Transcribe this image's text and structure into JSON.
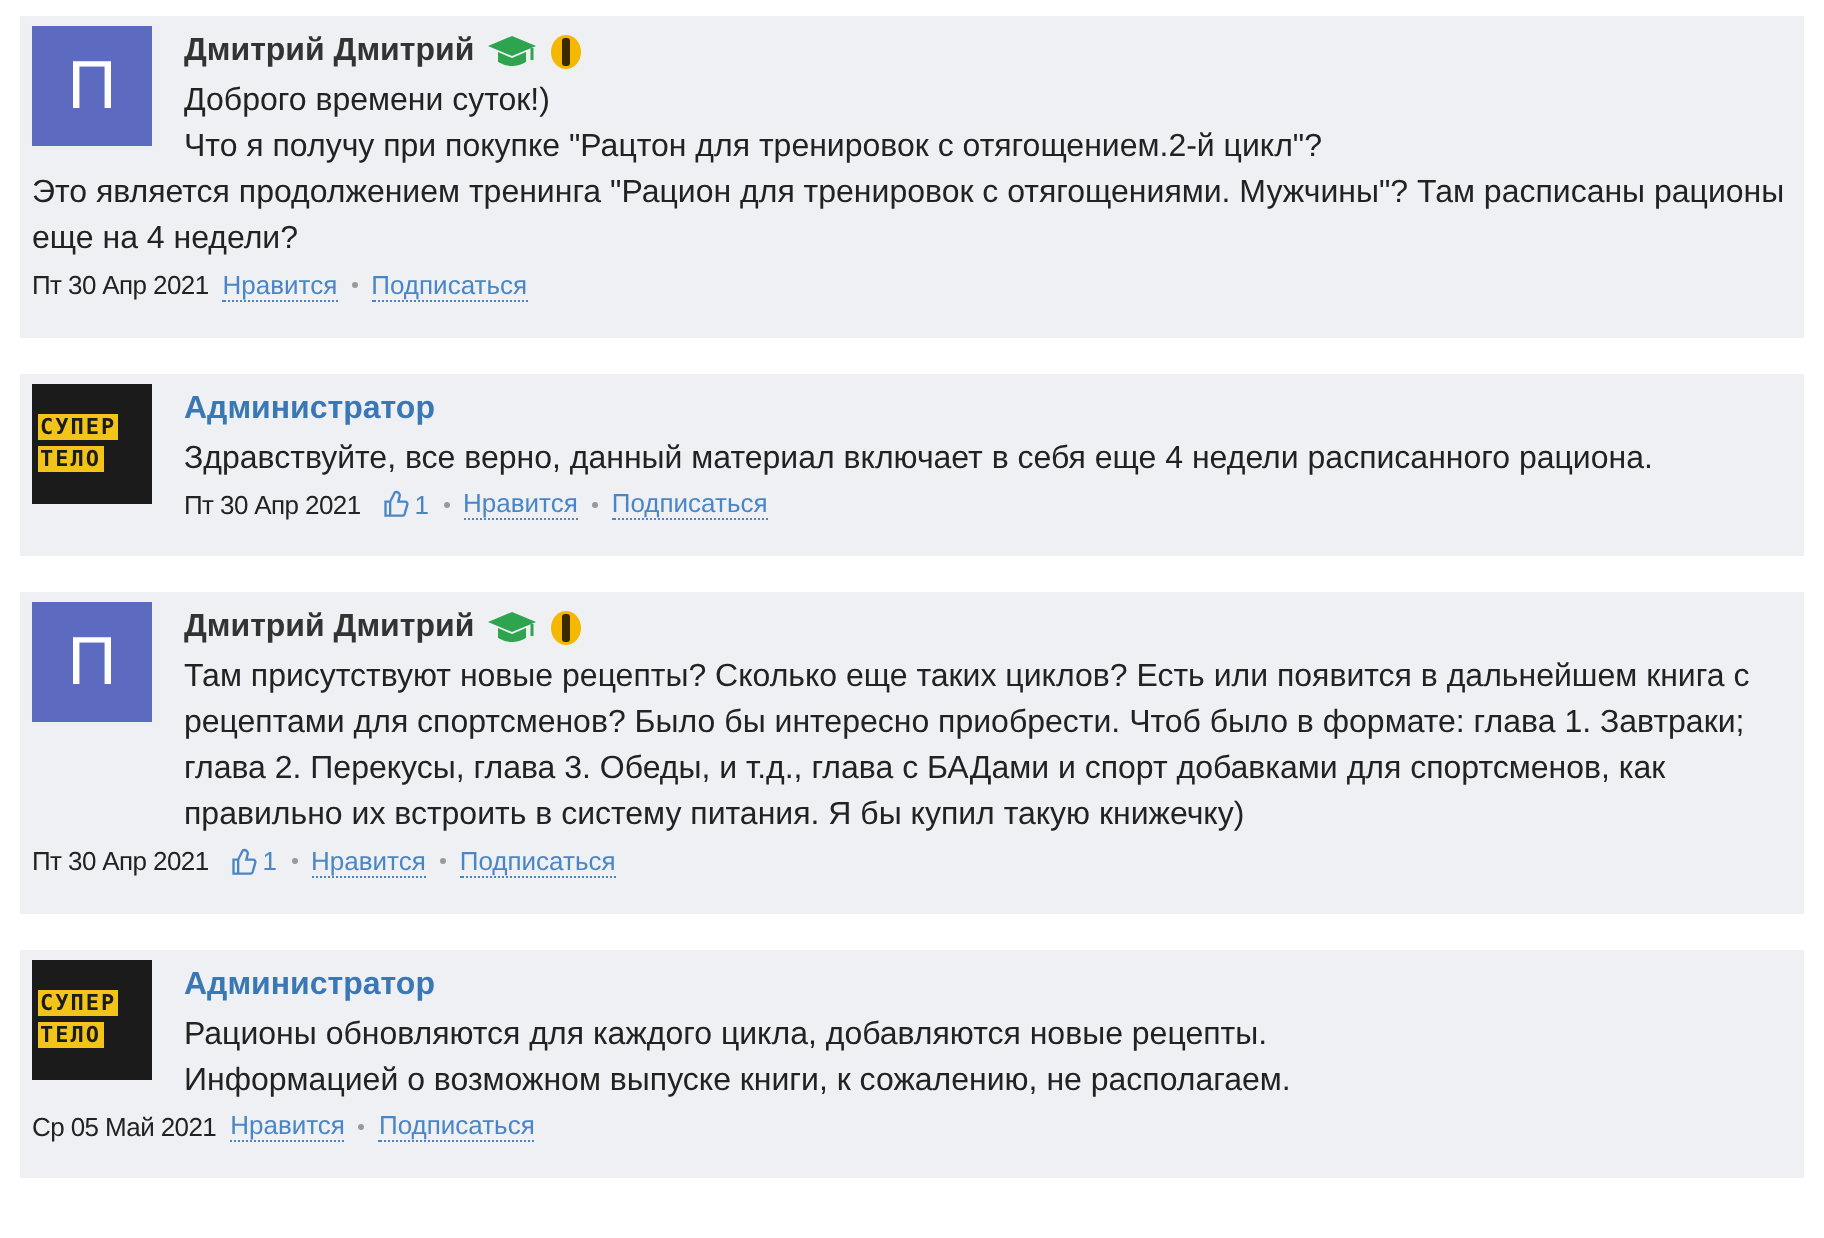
{
  "comments": [
    {
      "avatar": {
        "kind": "letter",
        "text": "П"
      },
      "author": {
        "name": "Дмитрий Дмитрий",
        "kind": "user",
        "badges": [
          {
            "kind": "cap"
          },
          {
            "kind": "coin"
          }
        ]
      },
      "lines": [
        "Доброго времени суток!)",
        "Что я получу при покупке \"Рацтон для тренировок с отягощением.2-й цикл\"?",
        "Это является продолжением тренинга \"Рацион для тренировок с отягощениями. Мужчины\"? Там расписаны рационы еще на 4 недели?"
      ],
      "date": "Пт 30 Апр 2021",
      "actions": [
        "Нравится",
        "Подписаться"
      ]
    },
    {
      "avatar": {
        "kind": "logo",
        "lines": [
          "СУПЕР",
          "ТЕЛО"
        ]
      },
      "author": {
        "name": "Администратор",
        "kind": "admin"
      },
      "lines": [
        "Здравствуйте, все верно, данный материал включает в себя еще 4 недели расписанного рациона."
      ],
      "date": "Пт 30 Апр 2021",
      "likes": "1",
      "actions": [
        "Нравится",
        "Подписаться"
      ]
    },
    {
      "avatar": {
        "kind": "letter",
        "text": "П"
      },
      "author": {
        "name": "Дмитрий Дмитрий",
        "kind": "user",
        "badges": [
          {
            "kind": "cap"
          },
          {
            "kind": "coin"
          }
        ]
      },
      "lines": [
        "Там присутствуют новые рецепты? Сколько еще таких циклов? Есть или появится в дальнейшем книга с рецептами для спортсменов? Было бы интересно приобрести. Чтоб было в формате: глава 1. Завтраки; глава 2. Перекусы, глава 3. Обеды, и т.д., глава с БАДами и спорт добавками для спортсменов, как правильно их встроить в систему питания. Я бы купил такую книжечку)"
      ],
      "date": "Пт 30 Апр 2021",
      "likes": "1",
      "actions": [
        "Нравится",
        "Подписаться"
      ]
    },
    {
      "avatar": {
        "kind": "logo",
        "lines": [
          "СУПЕР",
          "ТЕЛО"
        ]
      },
      "author": {
        "name": "Администратор",
        "kind": "admin"
      },
      "lines": [
        "Рационы обновляются для каждого цикла, добавляются новые рецепты.",
        "Информацией о возможном выпуске книги, к сожалению, не располагаем."
      ],
      "date": "Ср 05 Май 2021",
      "actions": [
        "Нравится",
        "Подписаться"
      ]
    }
  ]
}
